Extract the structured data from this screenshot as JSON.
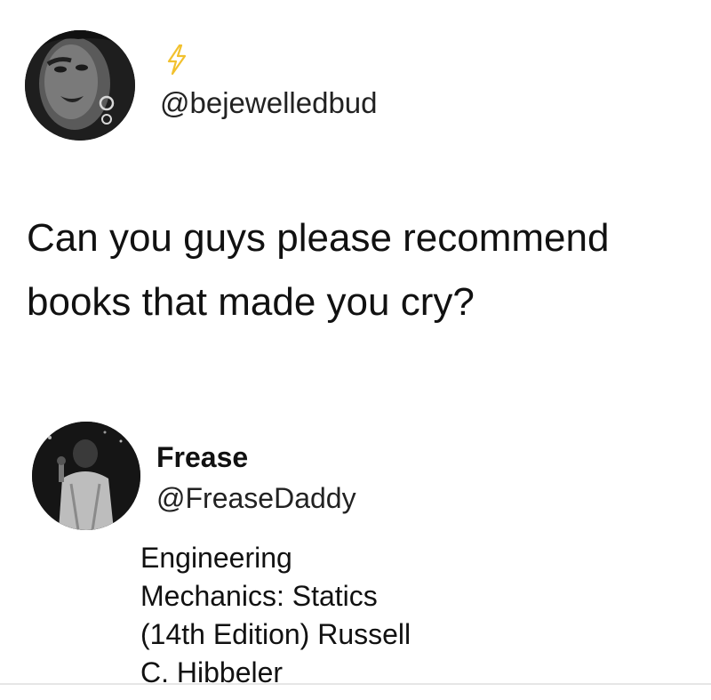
{
  "tweet": {
    "author": {
      "handle": "@bejewelledbud",
      "avatar": "profile-photo-woman-bw",
      "badge_icon": "lightning-bolt-icon",
      "badge_color": "#f2c12e"
    },
    "text": "Can you guys please recommend\nbooks that made you cry?"
  },
  "reply": {
    "author": {
      "display_name": "Frease",
      "handle": "@FreaseDaddy",
      "avatar": "profile-photo-man-bw"
    },
    "text_lines": [
      "Engineering",
      "Mechanics: Statics",
      "(14th Edition) Russell",
      "C. Hibbeler"
    ]
  }
}
